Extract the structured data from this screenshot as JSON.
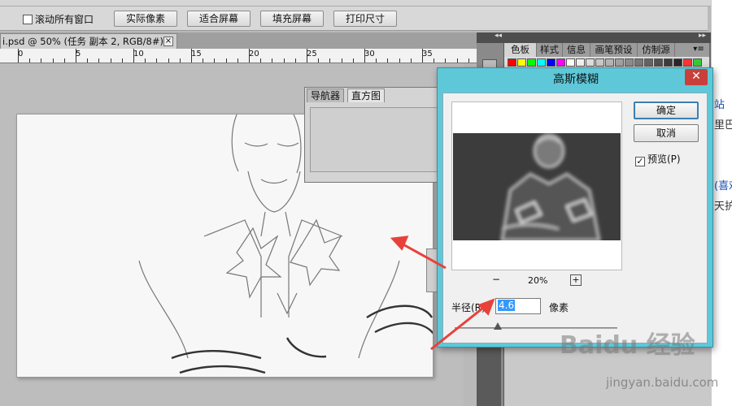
{
  "options_bar": {
    "scroll_all_label": "滚动所有窗口",
    "actual_pixels_label": "实际像素",
    "fit_screen_label": "适合屏幕",
    "fill_screen_label": "填充屏幕",
    "print_size_label": "打印尺寸"
  },
  "document": {
    "tab_title": "i.psd @ 50% (任务 副本 2, RGB/8#) *",
    "close_glyph": "×",
    "ruler_labels": [
      "0",
      "5",
      "10",
      "15",
      "20",
      "25",
      "30",
      "35"
    ]
  },
  "panels": {
    "collapse_left": "◂◂",
    "collapse_right": "▸▸",
    "tabs": [
      "色板",
      "样式",
      "信息",
      "画笔预设",
      "仿制源"
    ],
    "menu_icon": "▾≡",
    "swatch_colors": [
      "#ff0000",
      "#ffff00",
      "#00ff00",
      "#00ffff",
      "#0000ff",
      "#ff00ff",
      "#ffffff",
      "#f0f0f0",
      "#dddddd",
      "#c8c8c8",
      "#b4b4b4",
      "#a0a0a0",
      "#8c8c8c",
      "#787878",
      "#646464",
      "#505050",
      "#3c3c3c",
      "#282828",
      "#ff3333",
      "#33cc33"
    ],
    "navigator_tab": "导航器",
    "histogram_tab": "直方图"
  },
  "dialog": {
    "title": "高斯模糊",
    "close_glyph": "✕",
    "ok_label": "确定",
    "cancel_label": "取消",
    "preview_label": "预览(P)",
    "preview_checked": true,
    "zoom_out": "−",
    "zoom_level": "20%",
    "zoom_in": "+",
    "radius_label": "半径(R):",
    "radius_value": "4.6",
    "radius_unit": "像素"
  },
  "web": {
    "snippets": [
      "站",
      "里巴",
      "(喜欢",
      "天护"
    ]
  },
  "watermark": {
    "logo_text": "Baidu 经验",
    "url": "jingyan.baidu.com"
  },
  "colors": {
    "dialog_frame": "#5ec8d8",
    "close_red": "#c9403a",
    "arrow_red": "#e8413a"
  }
}
